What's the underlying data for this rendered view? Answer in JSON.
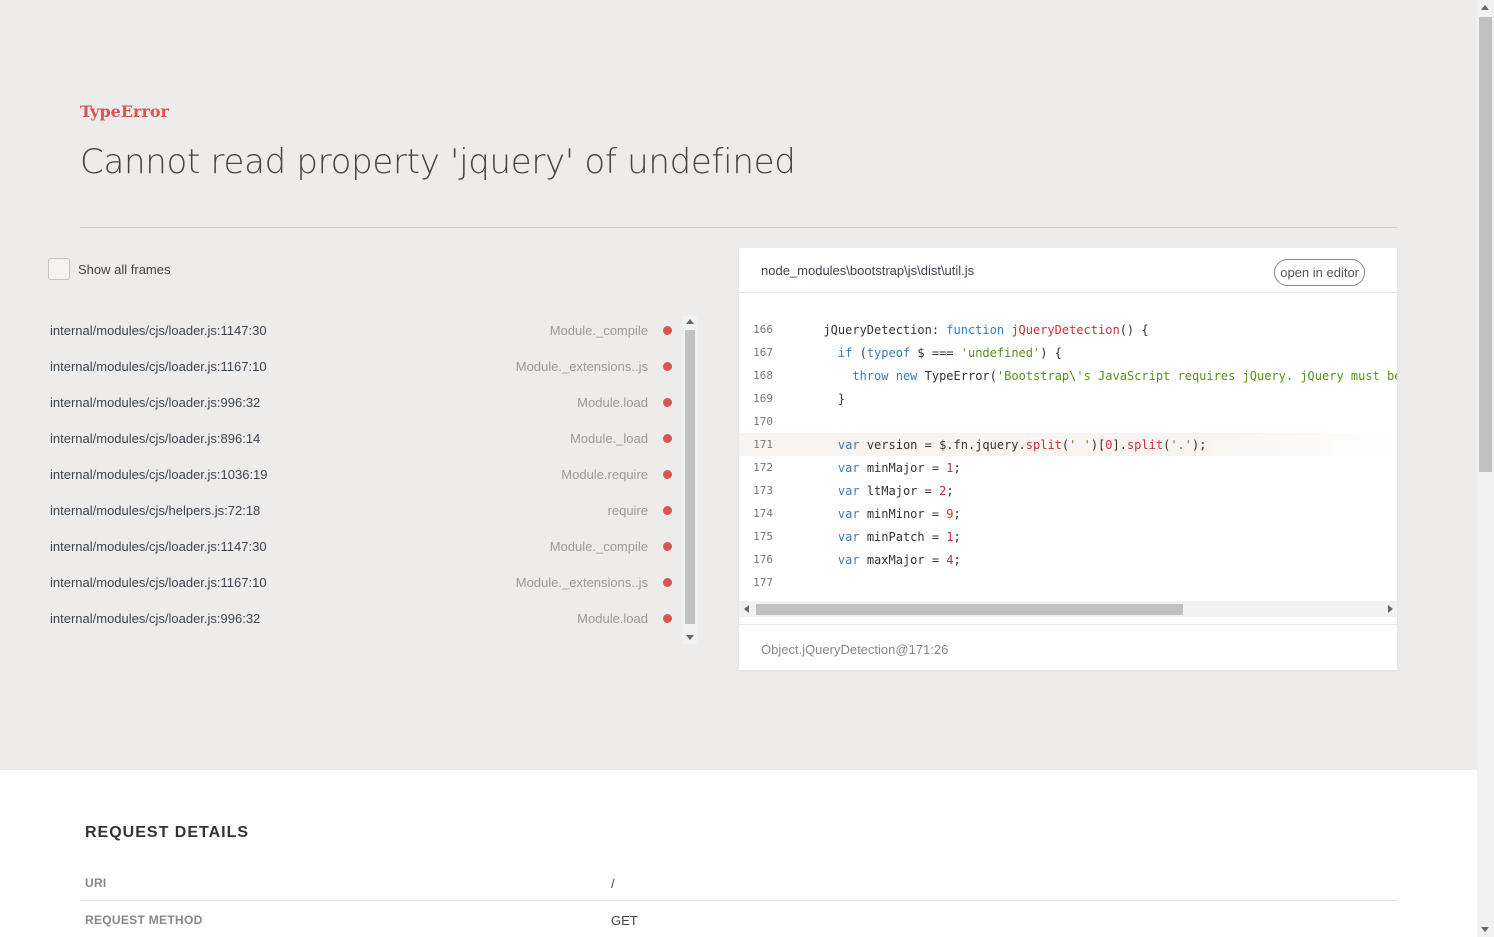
{
  "error": {
    "type": "TypeError",
    "message": "Cannot read property 'jquery' of undefined"
  },
  "show_all_frames": {
    "label": "Show all frames",
    "checked": false
  },
  "frames": [
    {
      "file": "internal/modules/cjs/loader.js:1147:30",
      "method": "Module._compile"
    },
    {
      "file": "internal/modules/cjs/loader.js:1167:10",
      "method": "Module._extensions..js"
    },
    {
      "file": "internal/modules/cjs/loader.js:996:32",
      "method": "Module.load"
    },
    {
      "file": "internal/modules/cjs/loader.js:896:14",
      "method": "Module._load"
    },
    {
      "file": "internal/modules/cjs/loader.js:1036:19",
      "method": "Module.require"
    },
    {
      "file": "internal/modules/cjs/helpers.js:72:18",
      "method": "require"
    },
    {
      "file": "internal/modules/cjs/loader.js:1147:30",
      "method": "Module._compile"
    },
    {
      "file": "internal/modules/cjs/loader.js:1167:10",
      "method": "Module._extensions..js"
    },
    {
      "file": "internal/modules/cjs/loader.js:996:32",
      "method": "Module.load"
    }
  ],
  "code": {
    "file": "node_modules\\bootstrap\\js\\dist\\util.js",
    "open_in_editor": "open in editor",
    "highlight_line": "171",
    "lines": [
      "166",
      "167",
      "168",
      "169",
      "170",
      "171",
      "172",
      "173",
      "174",
      "175",
      "176",
      "177"
    ],
    "footer": "Object.jQueryDetection@171:26"
  },
  "request": {
    "title": "REQUEST DETAILS",
    "rows": [
      {
        "key": "URI",
        "value": "/"
      },
      {
        "key": "REQUEST METHOD",
        "value": "GET"
      }
    ]
  },
  "colors": {
    "accent": "#d9534f",
    "keyword": "#3a7bb5",
    "string": "#5a8f1c"
  }
}
